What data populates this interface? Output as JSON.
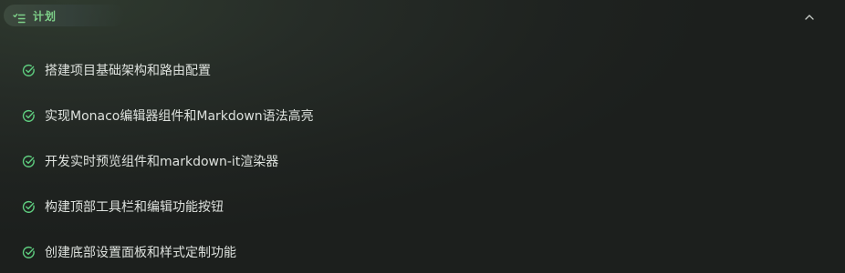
{
  "header": {
    "plan_label": "计划",
    "plan_icon": "list-checklist-icon",
    "collapse_icon": "chevron-up-icon"
  },
  "tasks": [
    {
      "text": "搭建项目基础架构和路由配置",
      "status": "done"
    },
    {
      "text": "实现Monaco编辑器组件和Markdown语法高亮",
      "status": "done"
    },
    {
      "text": "开发实时预览组件和markdown-it渲染器",
      "status": "done"
    },
    {
      "text": "构建顶部工具栏和编辑功能按钮",
      "status": "done"
    },
    {
      "text": "创建底部设置面板和样式定制功能",
      "status": "done"
    }
  ],
  "colors": {
    "accent_green": "#7ed089",
    "check_green": "#5fcf80",
    "text": "#dde1dd"
  }
}
